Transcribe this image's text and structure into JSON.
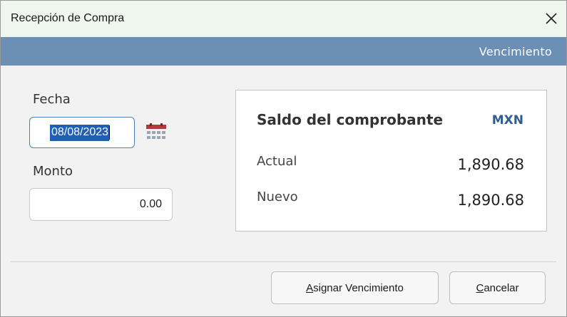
{
  "window": {
    "title": "Recepción de Compra",
    "close_glyph": "✕"
  },
  "banner": {
    "text": "Vencimiento"
  },
  "form": {
    "fecha_label": "Fecha",
    "fecha_value": "08/08/2023",
    "monto_label": "Monto",
    "monto_value": "0.00"
  },
  "saldo": {
    "title": "Saldo del comprobante",
    "currency": "MXN",
    "actual_label": "Actual",
    "actual_value": "1,890.68",
    "nuevo_label": "Nuevo",
    "nuevo_value": "1,890.68"
  },
  "buttons": {
    "assign_mnemonic": "A",
    "assign_rest": "signar Vencimiento",
    "cancel_mnemonic": "C",
    "cancel_rest": "ancelar"
  },
  "icons": {
    "close": "close-icon",
    "calendar": "calendar-icon"
  },
  "colors": {
    "banner": "#6b8fb5",
    "titlebar": "#eef6ee",
    "selection": "#1f5fb5",
    "currency": "#2e5d8f",
    "calendar_red": "#b23a3a"
  }
}
